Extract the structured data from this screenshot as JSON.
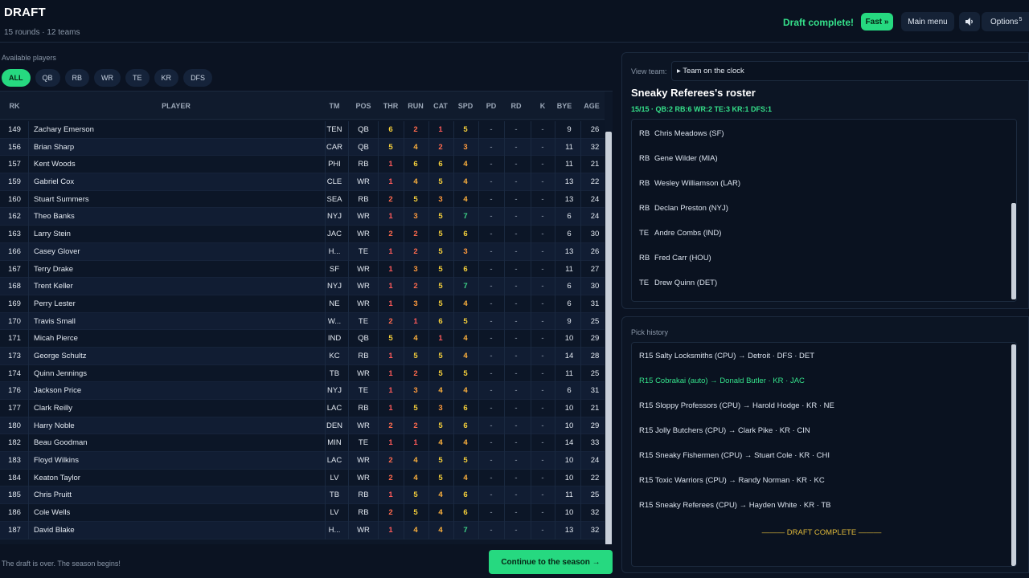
{
  "header": {
    "title": "DRAFT",
    "subtitle": "15 rounds · 12 teams",
    "status": "Draft complete!",
    "fast_label": "Fast »",
    "menu_label": "Main menu",
    "options_label": "Options",
    "options_badge": "5"
  },
  "players": {
    "label": "Available players",
    "filters": [
      "ALL",
      "QB",
      "RB",
      "WR",
      "TE",
      "KR",
      "DFS"
    ],
    "active_filter": "ALL",
    "columns": [
      "RK",
      "PLAYER",
      "TM",
      "POS",
      "THR",
      "RUN",
      "CAT",
      "SPD",
      "PD",
      "RD",
      "K",
      "BYE",
      "AGE"
    ],
    "rows": [
      [
        "149",
        "Zachary Emerson",
        "TEN",
        "QB",
        "6",
        "2",
        "1",
        "5",
        "-",
        "-",
        "-",
        "9",
        "26"
      ],
      [
        "156",
        "Brian Sharp",
        "CAR",
        "QB",
        "5",
        "4",
        "2",
        "3",
        "-",
        "-",
        "-",
        "11",
        "32"
      ],
      [
        "157",
        "Kent Woods",
        "PHI",
        "RB",
        "1",
        "6",
        "6",
        "4",
        "-",
        "-",
        "-",
        "11",
        "21"
      ],
      [
        "159",
        "Gabriel Cox",
        "CLE",
        "WR",
        "1",
        "4",
        "5",
        "4",
        "-",
        "-",
        "-",
        "13",
        "22"
      ],
      [
        "160",
        "Stuart Summers",
        "SEA",
        "RB",
        "2",
        "5",
        "3",
        "4",
        "-",
        "-",
        "-",
        "13",
        "24"
      ],
      [
        "162",
        "Theo Banks",
        "NYJ",
        "WR",
        "1",
        "3",
        "5",
        "7",
        "-",
        "-",
        "-",
        "6",
        "24"
      ],
      [
        "163",
        "Larry Stein",
        "JAC",
        "WR",
        "2",
        "2",
        "5",
        "6",
        "-",
        "-",
        "-",
        "6",
        "30"
      ],
      [
        "166",
        "Casey Glover",
        "H...",
        "TE",
        "1",
        "2",
        "5",
        "3",
        "-",
        "-",
        "-",
        "13",
        "26"
      ],
      [
        "167",
        "Terry Drake",
        "SF",
        "WR",
        "1",
        "3",
        "5",
        "6",
        "-",
        "-",
        "-",
        "11",
        "27"
      ],
      [
        "168",
        "Trent Keller",
        "NYJ",
        "WR",
        "1",
        "2",
        "5",
        "7",
        "-",
        "-",
        "-",
        "6",
        "30"
      ],
      [
        "169",
        "Perry Lester",
        "NE",
        "WR",
        "1",
        "3",
        "5",
        "4",
        "-",
        "-",
        "-",
        "6",
        "31"
      ],
      [
        "170",
        "Travis Small",
        "W...",
        "TE",
        "2",
        "1",
        "6",
        "5",
        "-",
        "-",
        "-",
        "9",
        "25"
      ],
      [
        "171",
        "Micah Pierce",
        "IND",
        "QB",
        "5",
        "4",
        "1",
        "4",
        "-",
        "-",
        "-",
        "10",
        "29"
      ],
      [
        "173",
        "George Schultz",
        "KC",
        "RB",
        "1",
        "5",
        "5",
        "4",
        "-",
        "-",
        "-",
        "14",
        "28"
      ],
      [
        "174",
        "Quinn Jennings",
        "TB",
        "WR",
        "1",
        "2",
        "5",
        "5",
        "-",
        "-",
        "-",
        "11",
        "25"
      ],
      [
        "176",
        "Jackson Price",
        "NYJ",
        "TE",
        "1",
        "3",
        "4",
        "4",
        "-",
        "-",
        "-",
        "6",
        "31"
      ],
      [
        "177",
        "Clark Reilly",
        "LAC",
        "RB",
        "1",
        "5",
        "3",
        "6",
        "-",
        "-",
        "-",
        "10",
        "21"
      ],
      [
        "180",
        "Harry Noble",
        "DEN",
        "WR",
        "2",
        "2",
        "5",
        "6",
        "-",
        "-",
        "-",
        "10",
        "29"
      ],
      [
        "182",
        "Beau Goodman",
        "MIN",
        "TE",
        "1",
        "1",
        "4",
        "4",
        "-",
        "-",
        "-",
        "14",
        "33"
      ],
      [
        "183",
        "Floyd Wilkins",
        "LAC",
        "WR",
        "2",
        "4",
        "5",
        "5",
        "-",
        "-",
        "-",
        "10",
        "24"
      ],
      [
        "184",
        "Keaton Taylor",
        "LV",
        "WR",
        "2",
        "4",
        "5",
        "4",
        "-",
        "-",
        "-",
        "10",
        "22"
      ],
      [
        "185",
        "Chris Pruitt",
        "TB",
        "RB",
        "1",
        "5",
        "4",
        "6",
        "-",
        "-",
        "-",
        "11",
        "25"
      ],
      [
        "186",
        "Cole Wells",
        "LV",
        "RB",
        "2",
        "5",
        "4",
        "6",
        "-",
        "-",
        "-",
        "10",
        "32"
      ],
      [
        "187",
        "David Blake",
        "H...",
        "WR",
        "1",
        "4",
        "4",
        "7",
        "-",
        "-",
        "-",
        "13",
        "32"
      ]
    ]
  },
  "rating_colors": {
    "1": "#ff5a5a",
    "2": "#ff6a4d",
    "3": "#ff9a3d",
    "4": "#ffb23d",
    "5": "#f3cd3a",
    "6": "#f6d03a",
    "7": "#3fd88a"
  },
  "footer": {
    "note": "The draft is over. The season begins!",
    "continue_label": "Continue to the season →"
  },
  "view_team": {
    "label": "View team:",
    "selected": "▸ Team on the clock"
  },
  "roster": {
    "title": "Sneaky Referees's roster",
    "summary": "15/15  ·  QB:2 RB:6 WR:2 TE:3 KR:1 DFS:1",
    "items": [
      {
        "pos": "RB",
        "name": "Chris Meadows  (SF)"
      },
      {
        "pos": "RB",
        "name": "Gene Wilder  (MIA)"
      },
      {
        "pos": "RB",
        "name": "Wesley Williamson  (LAR)"
      },
      {
        "pos": "RB",
        "name": "Declan Preston  (NYJ)"
      },
      {
        "pos": "TE",
        "name": "Andre Combs  (IND)"
      },
      {
        "pos": "RB",
        "name": "Fred Carr  (HOU)"
      },
      {
        "pos": "TE",
        "name": "Drew Quinn  (DET)"
      }
    ]
  },
  "history": {
    "label": "Pick history",
    "items": [
      "R15  Salty Locksmiths (CPU)  →  Detroit · DFS · DET",
      "R15  Cobrakai (auto)  →  Donald Butler · KR · JAC",
      "R15  Sloppy Professors (CPU)  →  Harold Hodge · KR · NE",
      "R15  Jolly Butchers (CPU)  →  Clark Pike · KR · CIN",
      "R15  Sneaky Fishermen (CPU)  →  Stuart Cole · KR · CHI",
      "R15  Toxic Warriors (CPU)  →  Randy Norman · KR · KC",
      "R15  Sneaky Referees (CPU)  →  Hayden White · KR · TB"
    ],
    "highlight_index": 1,
    "end_label": "——— DRAFT COMPLETE ———"
  }
}
